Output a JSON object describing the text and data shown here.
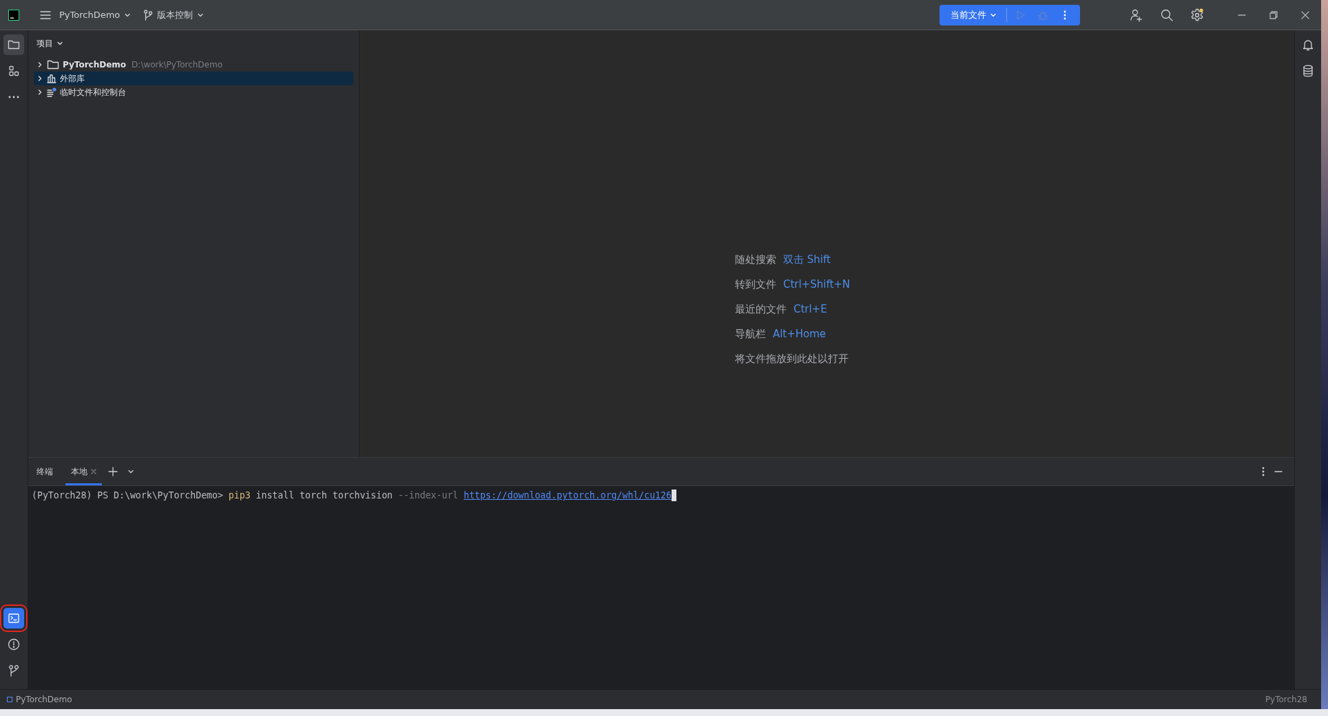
{
  "title_bar": {
    "project": "PyTorchDemo",
    "vcs": "版本控制",
    "run_config": "当前文件"
  },
  "left_tools": [
    {
      "kind": "folder",
      "selected": true
    },
    {
      "kind": "structure",
      "selected": false
    },
    {
      "kind": "more",
      "selected": false
    }
  ],
  "left_tools_bottom": [
    {
      "kind": "terminal",
      "selected": true,
      "highlighted": true
    },
    {
      "kind": "problems",
      "selected": false,
      "highlighted": false
    },
    {
      "kind": "git",
      "selected": false,
      "highlighted": false
    }
  ],
  "project_panel": {
    "title": "项目",
    "items": [
      {
        "kind": "folder",
        "label": "PyTorchDemo",
        "path": "D:\\work\\PyTorchDemo",
        "selected": false
      },
      {
        "kind": "library",
        "label": "外部库",
        "selected": true
      },
      {
        "kind": "scratch",
        "label": "临时文件和控制台",
        "selected": false
      }
    ]
  },
  "editor_hints": [
    {
      "text": "随处搜索",
      "shortcut": "双击 Shift"
    },
    {
      "text": "转到文件",
      "shortcut": "Ctrl+Shift+N"
    },
    {
      "text": "最近的文件",
      "shortcut": "Ctrl+E"
    },
    {
      "text": "导航栏",
      "shortcut": "Alt+Home"
    },
    {
      "text": "将文件拖放到此处以打开"
    }
  ],
  "terminal": {
    "title": "终端",
    "tabs": [
      {
        "label": "本地",
        "selected": true
      }
    ],
    "line": [
      {
        "kind": "prompt",
        "text": "(PyTorch28) PS D:\\work\\PyTorchDemo> "
      },
      {
        "kind": "command",
        "text": "pip3"
      },
      {
        "kind": "arg",
        "text": " install torch torchvision "
      },
      {
        "kind": "option",
        "text": "--index-url"
      },
      {
        "kind": "link",
        "text": "https://download.pytorch.org/whl/cu126"
      }
    ]
  },
  "status_bar": {
    "project": "PyTorchDemo",
    "interpreter": "PyTorch28"
  }
}
